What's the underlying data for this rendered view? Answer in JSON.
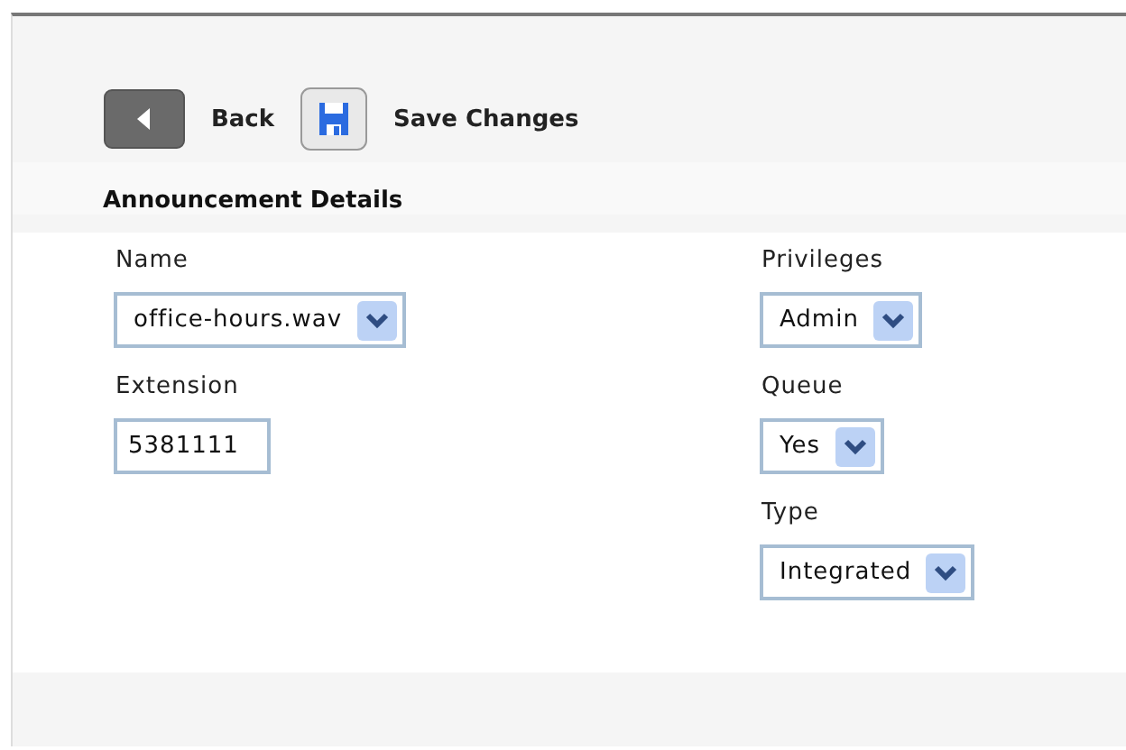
{
  "toolbar": [
    {
      "kind": "back",
      "label": "Back"
    },
    {
      "kind": "save",
      "label": "Save Changes"
    }
  ],
  "section": {
    "title": "Announcement Details",
    "columns": [
      [
        {
          "label": "Name",
          "kind": "select",
          "value": "office-hours.wav"
        },
        {
          "label": "Extension",
          "kind": "text",
          "value": "5381111"
        }
      ],
      [
        {
          "label": "Privileges",
          "kind": "select",
          "value": "Admin"
        },
        {
          "label": "Queue",
          "kind": "select",
          "value": "Yes"
        },
        {
          "label": "Type",
          "kind": "select",
          "value": "Integrated"
        }
      ]
    ]
  }
}
